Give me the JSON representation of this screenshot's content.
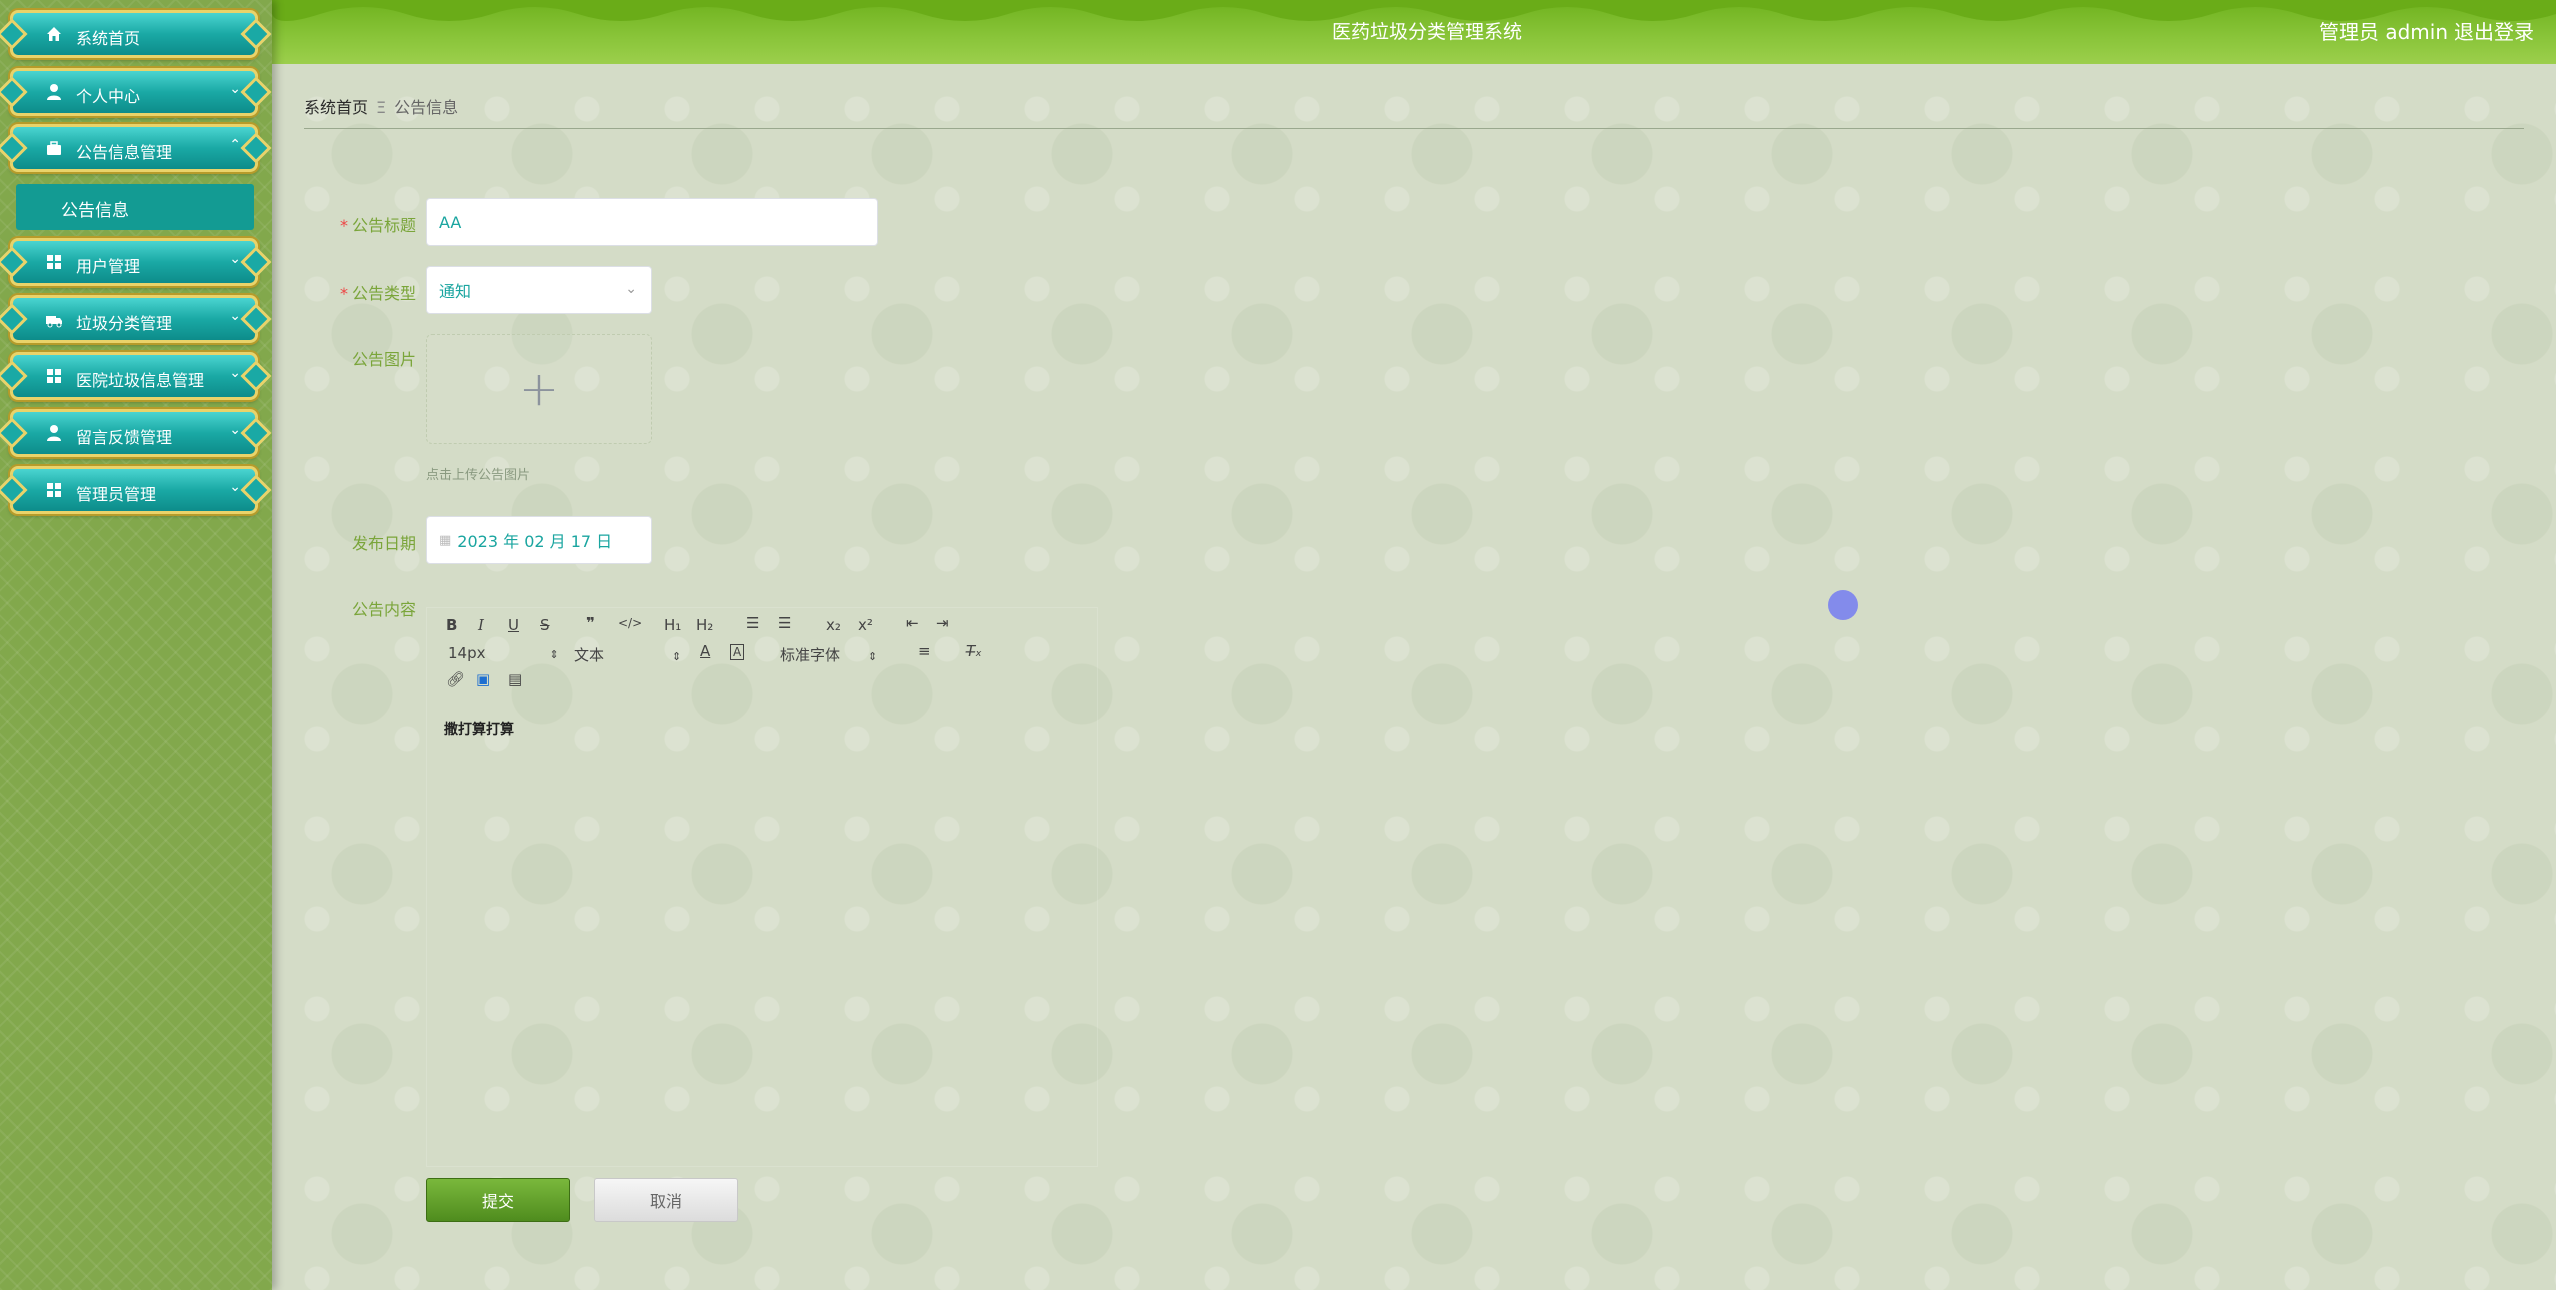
{
  "app": {
    "title": "医药垃圾分类管理系统",
    "user_label": "管理员 admin",
    "logout_label": "退出登录"
  },
  "sidebar": {
    "items": [
      {
        "label": "系统首页",
        "icon": "home-icon"
      },
      {
        "label": "个人中心",
        "icon": "user-icon"
      },
      {
        "label": "公告信息管理",
        "icon": "briefcase-icon"
      },
      {
        "label": "用户管理",
        "icon": "grid-icon"
      },
      {
        "label": "垃圾分类管理",
        "icon": "truck-icon"
      },
      {
        "label": "医院垃圾信息管理",
        "icon": "grid-icon"
      },
      {
        "label": "留言反馈管理",
        "icon": "user-icon"
      },
      {
        "label": "管理员管理",
        "icon": "grid-icon"
      }
    ],
    "submenu_active": "公告信息"
  },
  "breadcrumb": {
    "home": "系统首页",
    "separator": "Ξ",
    "current": "公告信息"
  },
  "form": {
    "title_label": "公告标题",
    "title_value": "AA",
    "type_label": "公告类型",
    "type_value": "通知",
    "image_label": "公告图片",
    "image_hint": "点击上传公告图片",
    "date_label": "发布日期",
    "date_value": "2023 年 02 月 17 日",
    "content_label": "公告内容",
    "content_value": "撒打算打算",
    "submit_label": "提交",
    "cancel_label": "取消"
  },
  "editor": {
    "font_size": "14px",
    "format": "文本",
    "font_family": "标准字体"
  },
  "colors": {
    "accent": "#7aa53a",
    "teal": "#1aa9a5",
    "header_green": "#8ac53a"
  }
}
